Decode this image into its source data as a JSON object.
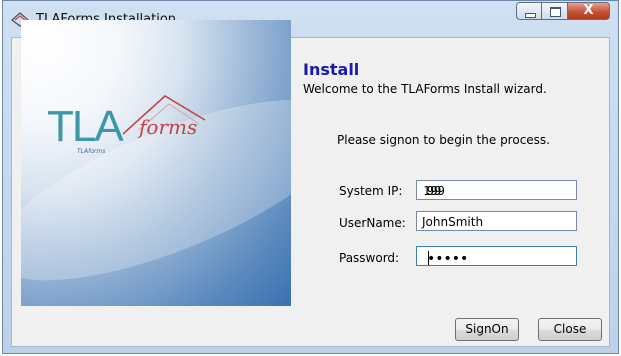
{
  "window": {
    "title": "TLAForms Installation",
    "close_glyph": "X"
  },
  "banner": {
    "logo_main": "TLA",
    "logo_script": "forms",
    "logo_small": "TLAforms"
  },
  "content": {
    "heading": "Install",
    "welcome": "Welcome to the TLAForms Install wizard.",
    "signon_prompt": "Please signon to begin the process."
  },
  "form": {
    "system_ip_label": "System IP:",
    "system_ip": [
      "199",
      "99",
      "9",
      "99"
    ],
    "ip_separator": ".",
    "username_label": "UserName:",
    "username_value": "JohnSmith",
    "password_label": "Password:",
    "password_value": "•••••"
  },
  "buttons": {
    "signon": "SignOn",
    "close": "Close"
  },
  "colors": {
    "heading": "#1a1ab0",
    "logo_teal": "#3e97a8",
    "logo_red": "#c24545",
    "close_red": "#c45234"
  }
}
